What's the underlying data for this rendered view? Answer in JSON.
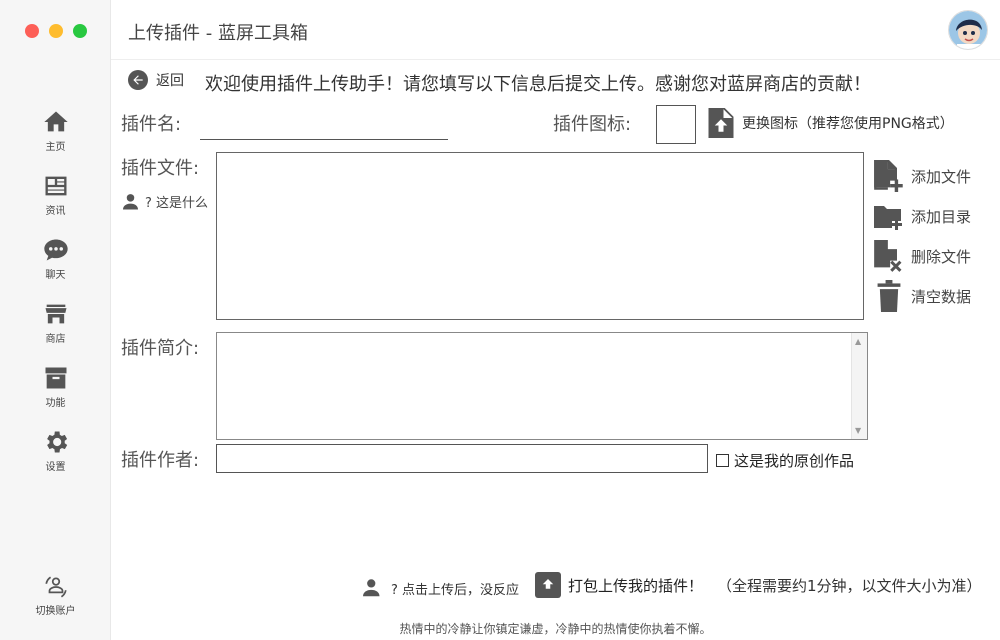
{
  "window": {
    "title": "上传插件 - 蓝屏工具箱"
  },
  "sidebar": {
    "items": [
      {
        "label": "主页",
        "icon": "home-icon"
      },
      {
        "label": "资讯",
        "icon": "news-icon"
      },
      {
        "label": "聊天",
        "icon": "chat-icon"
      },
      {
        "label": "商店",
        "icon": "store-icon"
      },
      {
        "label": "功能",
        "icon": "archive-icon"
      },
      {
        "label": "设置",
        "icon": "gear-icon"
      }
    ],
    "switch_account": {
      "label": "切换账户",
      "icon": "switch-account-icon"
    }
  },
  "header": {
    "back_label": "返回",
    "welcome": "欢迎使用插件上传助手！请您填写以下信息后提交上传。感谢您对蓝屏商店的贡献！"
  },
  "form": {
    "name_label": "插件名:",
    "name_value": "",
    "icon_label": "插件图标:",
    "change_icon_label": "更换图标（推荐您使用PNG格式）",
    "file_label": "插件文件:",
    "what_is_label": "? 这是什么",
    "file_actions": {
      "add_file": "添加文件",
      "add_dir": "添加目录",
      "delete_file": "删除文件",
      "clear_data": "清空数据"
    },
    "desc_label": "插件简介:",
    "desc_value": "",
    "author_label": "插件作者:",
    "author_value": "",
    "original_label": "这是我的原创作品",
    "original_checked": false
  },
  "bottom": {
    "no_response": "? 点击上传后，没反应",
    "pack_label": "打包上传我的插件！",
    "pack_note": "（全程需要约1分钟，以文件大小为准）",
    "footer": "热情中的冷静让你镇定谦虚，冷静中的热情使你执着不懈。"
  },
  "colors": {
    "icon": "#555555",
    "sidebar_bg": "#f6f6f6",
    "traffic_red": "#fd5f57",
    "traffic_yellow": "#febc2e",
    "traffic_green": "#28c840"
  }
}
